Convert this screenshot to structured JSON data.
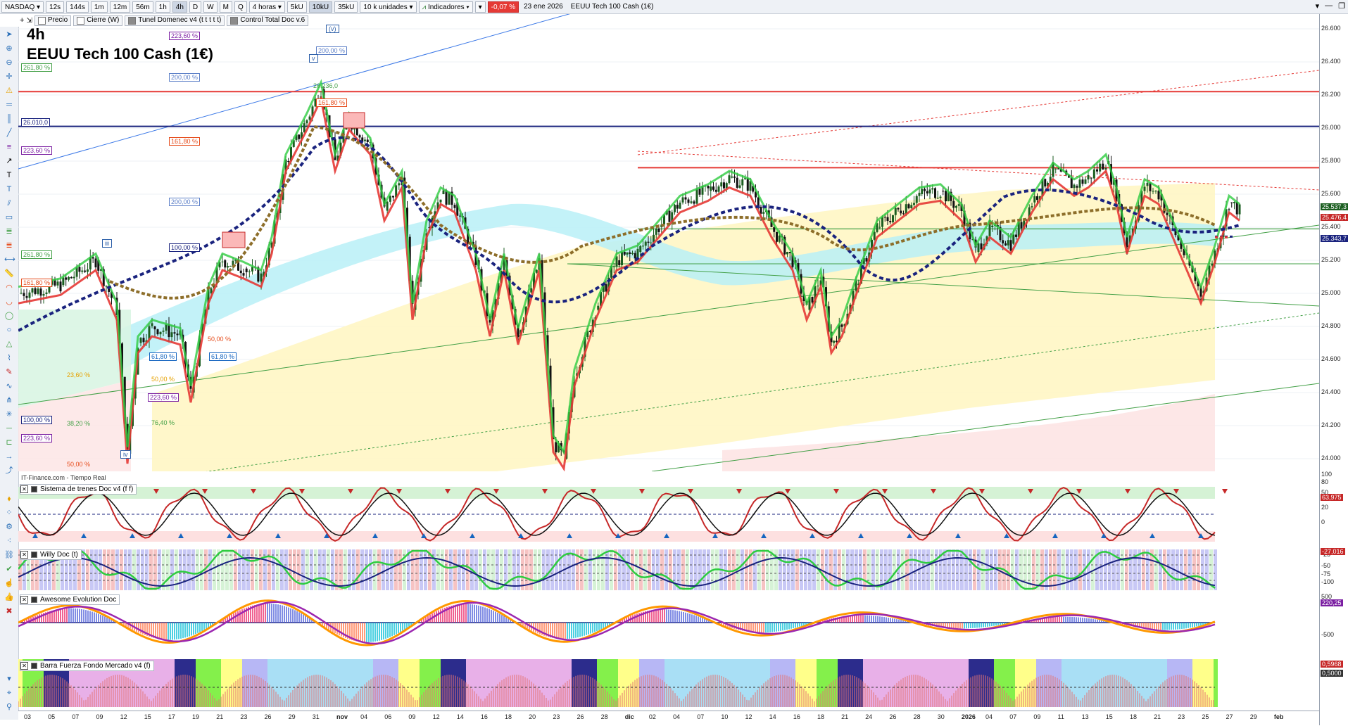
{
  "toolbar": {
    "symbol": "NASDAQ",
    "periods": [
      "12s",
      "144s",
      "1m",
      "12m",
      "56m",
      "1h",
      "4h",
      "D",
      "W",
      "M",
      "Q"
    ],
    "active_period": "4h",
    "interval_label": "4 horas",
    "units": [
      "5kU",
      "10kU",
      "35kU"
    ],
    "active_unit": "10kU",
    "units_label": "10 k unidades",
    "indicators_label": "Indicadores",
    "change": "-0,07 %",
    "date": "23 ene 2026",
    "instrument": "EEUU Tech 100 Cash (1€)"
  },
  "toolbar2": {
    "items": [
      "Precio",
      "Cierre (W)",
      "Tunel Domenec v4 (t t t t t)",
      "Control Total Doc v.6"
    ]
  },
  "chart_title": {
    "timeframe": "4h",
    "name": "EEUU Tech 100 Cash (1€)"
  },
  "source_label": "IT-Finance.com - Tiempo Real",
  "price_axis": {
    "ticks": [
      "26.600",
      "26.400",
      "26.200",
      "26.000",
      "25.800",
      "25.600",
      "25.400",
      "25.200",
      "25.000",
      "24.800",
      "24.600",
      "24.400",
      "24.200",
      "24.000"
    ],
    "tags": [
      {
        "text": "25.537,3",
        "color": "#1b5e20"
      },
      {
        "text": "25.476,4",
        "color": "#c62828"
      },
      {
        "text": "25.343,7",
        "color": "#1a237e"
      }
    ]
  },
  "fib_labels": [
    {
      "text": "223,60 %",
      "color": "#7b1fa2"
    },
    {
      "text": "261,80 %",
      "color": "#43a047"
    },
    {
      "text": "200,00 %",
      "color": "#5c7fc7"
    },
    {
      "text": "26.010,0",
      "color": "#1a237e"
    },
    {
      "text": "161,80 %",
      "color": "#e64a19"
    },
    {
      "text": "223,60 %",
      "color": "#7b1fa2"
    },
    {
      "text": "200,00 %",
      "color": "#5c7fc7"
    },
    {
      "text": "100,00 %",
      "color": "#1a237e"
    },
    {
      "text": "261,80 %",
      "color": "#43a047"
    },
    {
      "text": "161,80 %",
      "color": "#e64a19"
    },
    {
      "text": "100,00 %",
      "color": "#1a237e"
    },
    {
      "text": "223,60 %",
      "color": "#7b1fa2"
    },
    {
      "text": "61,80 %",
      "color": "#1565c0"
    },
    {
      "text": "61,80 %",
      "color": "#1565c0"
    },
    {
      "text": "223,60 %",
      "color": "#7b1fa2"
    },
    {
      "text": "200,00 %",
      "color": "#5c7fc7"
    },
    {
      "text": "161,80 %",
      "color": "#e64a19"
    }
  ],
  "fib_texts": [
    "50,00 %",
    "23,60 %",
    "38,20 %",
    "50,00 %",
    "76,40 %",
    "50,00 %",
    "26.236,0"
  ],
  "waves": [
    "(v)",
    "v",
    "iii",
    "iv"
  ],
  "panels": {
    "p1": {
      "title": "Sistema de trenes Doc v4 (f f)",
      "ticks": [
        "100",
        "80",
        "50",
        "20",
        "0"
      ],
      "value": "63,975"
    },
    "p2": {
      "title": "Willy Doc (t)",
      "ticks": [
        "-25",
        "-50",
        "-75",
        "-100"
      ],
      "value": "-27,016"
    },
    "p3": {
      "title": "Awesome Evolution Doc",
      "ticks": [
        "500",
        "-500"
      ],
      "value": "220,25"
    },
    "p4": {
      "title": "Barra Fuerza Fondo Mercado v4 (f)",
      "values": [
        "0,5968",
        "0,5000"
      ]
    }
  },
  "time_axis": [
    "03",
    "05",
    "07",
    "09",
    "12",
    "15",
    "17",
    "19",
    "21",
    "23",
    "26",
    "29",
    "31",
    "nov",
    "04",
    "06",
    "09",
    "12",
    "14",
    "16",
    "18",
    "20",
    "23",
    "26",
    "28",
    "dic",
    "02",
    "04",
    "07",
    "10",
    "12",
    "14",
    "16",
    "18",
    "21",
    "24",
    "26",
    "28",
    "30",
    "2026",
    "04",
    "07",
    "09",
    "11",
    "13",
    "15",
    "18",
    "21",
    "23",
    "25",
    "27",
    "29",
    "feb"
  ]
}
